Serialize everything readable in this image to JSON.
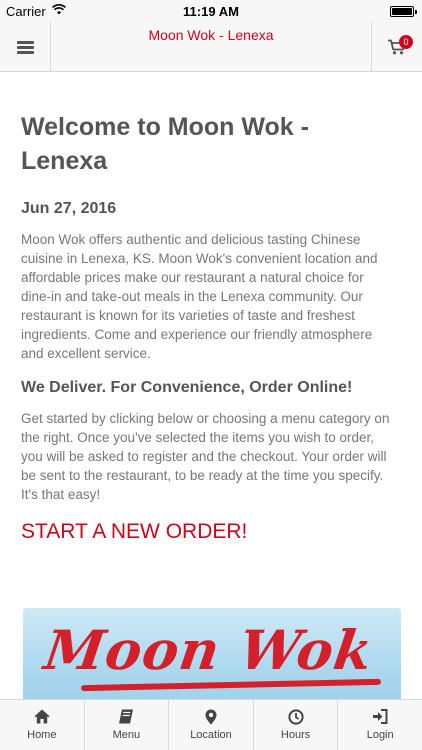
{
  "status_bar": {
    "carrier": "Carrier",
    "time": "11:19 AM"
  },
  "header": {
    "title": "Moon Wok - Lenexa",
    "cart_count": "0"
  },
  "main": {
    "heading": "Welcome to Moon Wok - Lenexa",
    "date": "Jun 27, 2016",
    "intro": "Moon Wok offers authentic and delicious tasting Chinese cuisine in Lenexa, KS. Moon Wok's convenient location and affordable prices make our restaurant a natural choice for dine-in and take-out meals in the Lenexa community. Our restaurant is known for its varieties of taste and freshest ingredients. Come and experience our friendly atmosphere and excellent service.",
    "subheading": "We Deliver. For Convenience, Order Online!",
    "instructions": "Get started by clicking below or choosing a menu category on the right. Once you've selected the items you wish to order, you will be asked to register and the checkout. Your order will be sent to the restaurant, to be ready at the time you specify. It's that easy!",
    "cta": "START A NEW ORDER!",
    "banner_logo": "Moon Wok"
  },
  "tabs": [
    {
      "label": "Home",
      "icon": "home-icon"
    },
    {
      "label": "Menu",
      "icon": "book-icon"
    },
    {
      "label": "Location",
      "icon": "map-marker-icon"
    },
    {
      "label": "Hours",
      "icon": "clock-icon"
    },
    {
      "label": "Login",
      "icon": "sign-in-icon"
    }
  ],
  "colors": {
    "accent": "#d0021b",
    "chrome": "#f7f7f7",
    "text": "#555555"
  }
}
